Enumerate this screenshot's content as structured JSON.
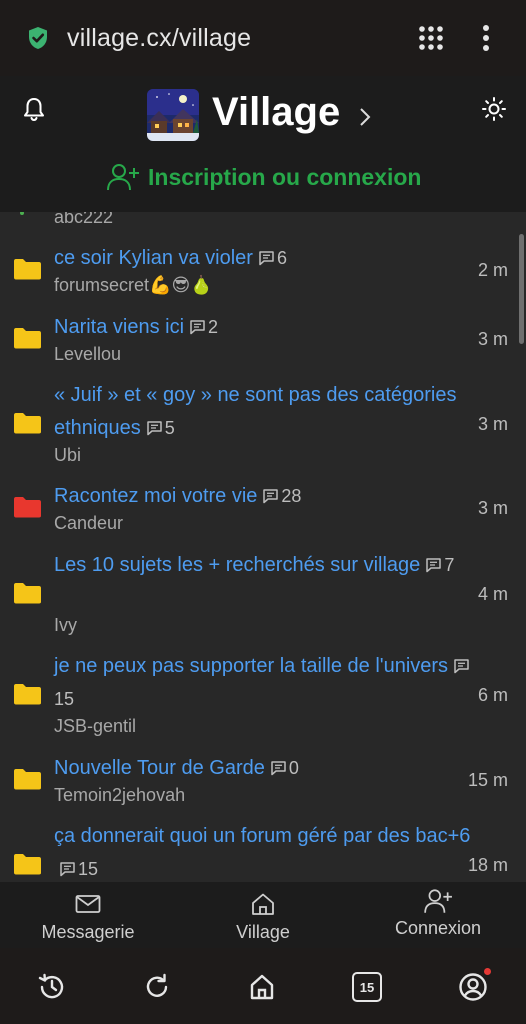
{
  "browser": {
    "url": "village.cx/village",
    "tab_count": "15",
    "icons": [
      "shield-check-icon",
      "apps-grid-icon",
      "more-vert-icon",
      "history-icon",
      "reload-icon",
      "home-icon",
      "tabs-icon",
      "account-icon"
    ]
  },
  "header": {
    "site_title": "Village",
    "login_label": "Inscription ou connexion"
  },
  "topics": [
    {
      "title": "ce soir Kylian va violer",
      "count": "6",
      "author": "forumsecret💪😎🍐",
      "age": "2 m",
      "folder_color": "#f5c518"
    },
    {
      "title": "Narita viens ici",
      "count": "2",
      "author": "Levellou",
      "age": "3 m",
      "folder_color": "#f5c518"
    },
    {
      "title": "« Juif » et « goy » ne sont pas des catégories ethniques",
      "count": "5",
      "author": "Ubi",
      "age": "3 m",
      "folder_color": "#f5c518"
    },
    {
      "title": "Racontez moi votre vie",
      "count": "28",
      "author": "Candeur",
      "age": "3 m",
      "folder_color": "#e8372e"
    },
    {
      "title": "Les 10 sujets les + recherchés sur village",
      "count": "7",
      "author": "Ivy",
      "age": "4 m",
      "folder_color": "#f5c518"
    },
    {
      "title": "je ne peux pas supporter la taille de l'univers",
      "count": "15",
      "author": "JSB-gentil",
      "age": "6 m",
      "folder_color": "#f5c518"
    },
    {
      "title": "Nouvelle Tour de Garde",
      "count": "0",
      "author": "Temoin2jehovah",
      "age": "15 m",
      "folder_color": "#f5c518"
    },
    {
      "title": "ça donnerait quoi un forum géré par des bac+6",
      "count": "15",
      "author": "",
      "age": "18 m",
      "folder_color": "#f5c518"
    }
  ],
  "partial_author": "abc222",
  "nav": {
    "messages": "Messagerie",
    "village": "Village",
    "login": "Connexion"
  }
}
